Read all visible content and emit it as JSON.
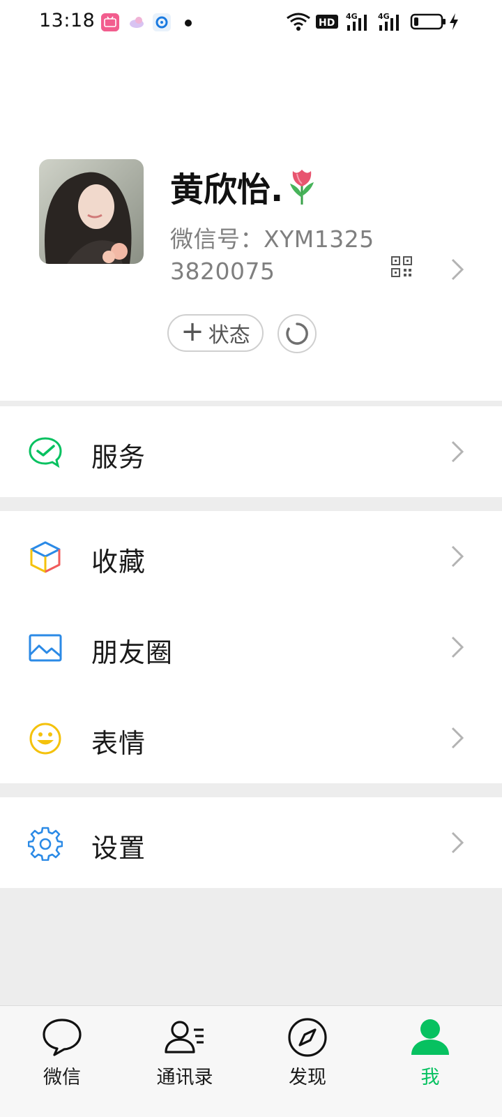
{
  "status_bar": {
    "time": "13:18",
    "notification_icons": [
      "bilibili-icon",
      "soul-icon",
      "qq-browser-icon"
    ],
    "indicators": [
      "wifi-icon",
      "hd-icon",
      "signal-4g-icon",
      "signal-4g-icon",
      "battery-icon",
      "charging-icon"
    ],
    "network_1": "4G",
    "network_2": "4G",
    "hd": "HD"
  },
  "profile": {
    "nickname": "黄欣怡.",
    "nickname_emoji": "🌷",
    "wechat_id_label": "微信号：",
    "wechat_id": "XYM13253820075",
    "status_button_label": "状态",
    "avatar_icon": "avatar"
  },
  "menu": {
    "services": {
      "label": "服务",
      "icon": "services-icon",
      "color": "#07c160"
    },
    "favorites": {
      "label": "收藏",
      "icon": "favorites-cube-icon"
    },
    "moments": {
      "label": "朋友圈",
      "icon": "moments-image-icon",
      "color": "#2b8ae6"
    },
    "stickers": {
      "label": "表情",
      "icon": "stickers-smiley-icon",
      "color": "#f4c20d"
    },
    "settings": {
      "label": "设置",
      "icon": "gear-icon",
      "color": "#2b8ae6"
    }
  },
  "tabbar": {
    "tabs": [
      {
        "label": "微信",
        "icon": "chat-bubble-icon"
      },
      {
        "label": "通讯录",
        "icon": "contacts-icon"
      },
      {
        "label": "发现",
        "icon": "compass-icon"
      },
      {
        "label": "我",
        "icon": "me-icon",
        "active": true
      }
    ],
    "active_color": "#07c160"
  }
}
